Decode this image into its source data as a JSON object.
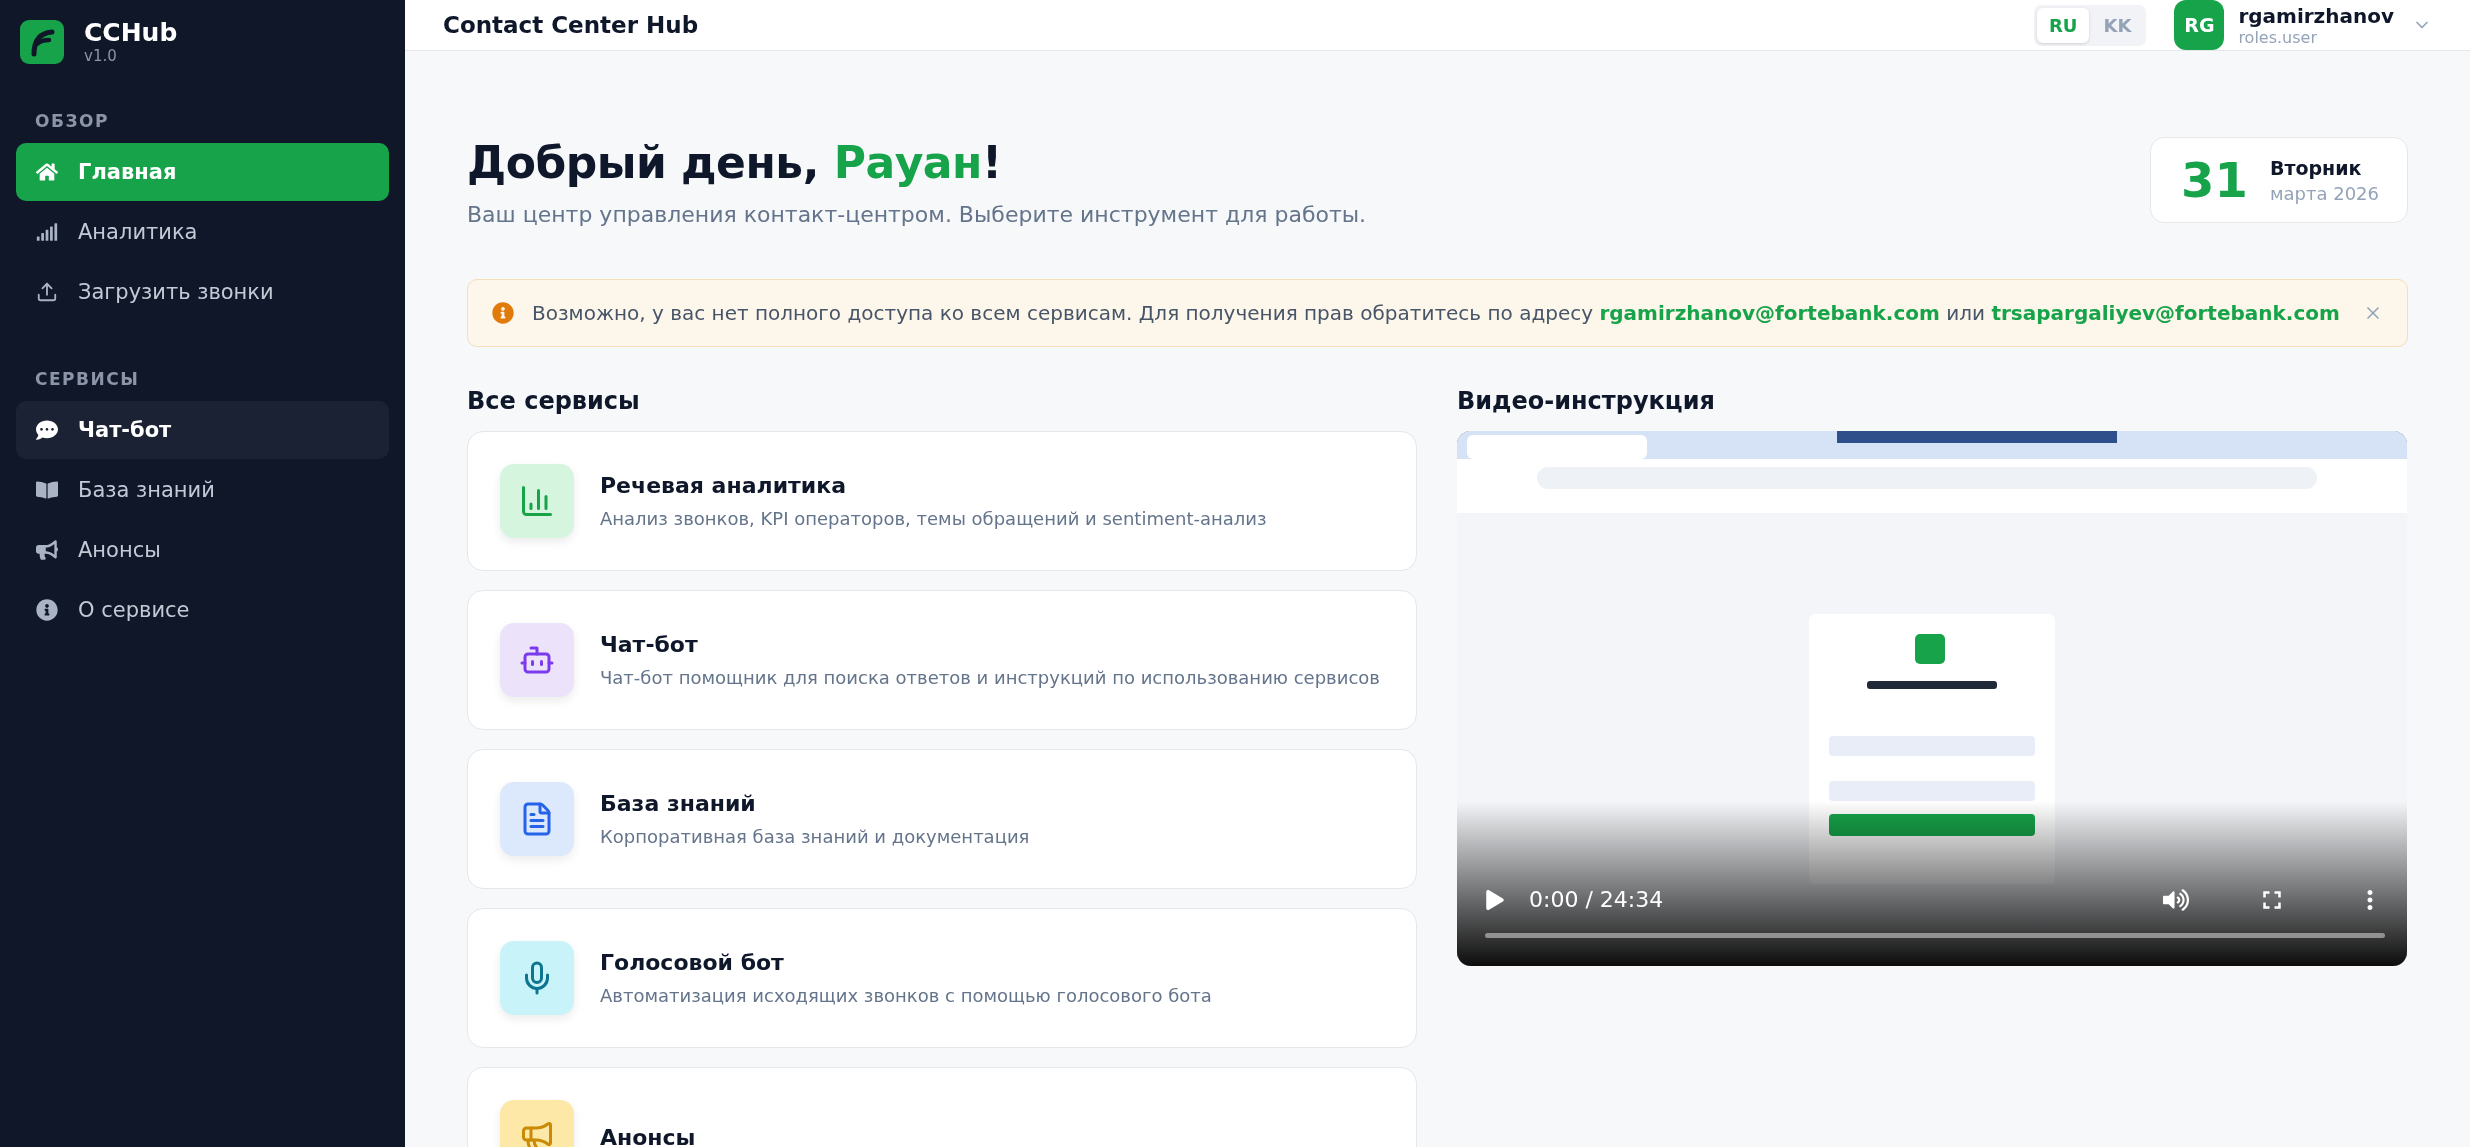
{
  "sidebar": {
    "logo": {
      "title": "CCHub",
      "version": "v1.0"
    },
    "sections": [
      {
        "title": "ОБЗОР",
        "items": [
          {
            "label": "Главная",
            "kind": "home",
            "selected": true,
            "hovered": false
          },
          {
            "label": "Аналитика",
            "kind": "analytics",
            "selected": false,
            "hovered": false
          },
          {
            "label": "Загрузить звонки",
            "kind": "upload",
            "selected": false,
            "hovered": false
          }
        ]
      },
      {
        "title": "СЕРВИСЫ",
        "items": [
          {
            "label": "Чат-бот",
            "kind": "chat",
            "selected": false,
            "hovered": true
          },
          {
            "label": "База знаний",
            "kind": "knowledge",
            "selected": false,
            "hovered": false
          },
          {
            "label": "Анонсы",
            "kind": "announcements",
            "selected": false,
            "hovered": false
          },
          {
            "label": "О сервисе",
            "kind": "about",
            "selected": false,
            "hovered": false
          }
        ]
      }
    ]
  },
  "header": {
    "title": "Contact Center Hub",
    "languages": [
      {
        "label": "RU",
        "selected": true
      },
      {
        "label": "KK",
        "selected": false
      }
    ],
    "user": {
      "initials": "RG",
      "name": "rgamirzhanov",
      "role": "roles.user"
    }
  },
  "greeting": {
    "text": "Добрый день, ",
    "name": "Рауан",
    "end": "!",
    "subtitle": "Ваш центр управления контакт-центром. Выберите инструмент для работы."
  },
  "date": {
    "day": "31",
    "weekday": "Вторник",
    "month_year": "марта 2026"
  },
  "alert": {
    "text": "Возможно, у вас нет полного доступа ко всем сервисам. Для получения прав обратитесь по адресу",
    "email_1": "rgamirzhanov@fortebank.com",
    "joiner": "или",
    "email_2": "trsapargaliyev@fortebank.com"
  },
  "services": {
    "title": "Все сервисы",
    "items": [
      {
        "kind": "analytics",
        "title": "Речевая аналитика",
        "description": "Анализ звонков, KPI операторов, темы обращений и sentiment-анализ"
      },
      {
        "kind": "chat",
        "title": "Чат-бот",
        "description": "Чат-бот помощник для поиска ответов и инструкций по использованию сервисов"
      },
      {
        "kind": "knowledge",
        "title": "База знаний",
        "description": "Корпоративная база знаний и документация"
      },
      {
        "kind": "voice",
        "title": "Голосовой бот",
        "description": "Автоматизация исходящих звонков с помощью голосового бота"
      },
      {
        "kind": "announcements",
        "title": "Анонсы"
      }
    ]
  },
  "video": {
    "title": "Видео-инструкция",
    "time": "0:00 / 24:34"
  }
}
